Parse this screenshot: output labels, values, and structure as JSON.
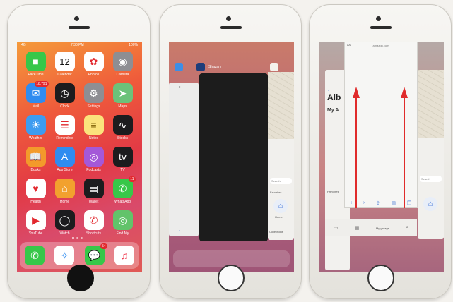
{
  "phone1": {
    "status": {
      "carrier": "4G",
      "time": "7:30 PM",
      "battery": "100%"
    },
    "apps": [
      {
        "label": "FaceTime",
        "icon": "facetime-icon",
        "color": "#37c749",
        "glyph": "■"
      },
      {
        "label": "Calendar",
        "icon": "calendar-icon",
        "color": "#ffffff",
        "glyph": "12",
        "sub": "Tuesday"
      },
      {
        "label": "Photos",
        "icon": "photos-icon",
        "color": "#ffffff",
        "glyph": "✿"
      },
      {
        "label": "Camera",
        "icon": "camera-icon",
        "color": "#8e8e93",
        "glyph": "◉"
      },
      {
        "label": "Mail",
        "icon": "mail-icon",
        "color": "#2f8cf0",
        "glyph": "✉",
        "badge": "18,791"
      },
      {
        "label": "Clock",
        "icon": "clock-icon",
        "color": "#1c1c1e",
        "glyph": "◷"
      },
      {
        "label": "Settings",
        "icon": "settings-icon",
        "color": "#8e8e93",
        "glyph": "⚙"
      },
      {
        "label": "Maps",
        "icon": "maps-icon",
        "color": "#6cc27a",
        "glyph": "➤"
      },
      {
        "label": "Weather",
        "icon": "weather-icon",
        "color": "#3d9cf0",
        "glyph": "☀"
      },
      {
        "label": "Reminders",
        "icon": "reminders-icon",
        "color": "#ffffff",
        "glyph": "☰"
      },
      {
        "label": "Notes",
        "icon": "notes-icon",
        "color": "#fbe37c",
        "glyph": "≡"
      },
      {
        "label": "Stocks",
        "icon": "stocks-icon",
        "color": "#1c1c1e",
        "glyph": "∿"
      },
      {
        "label": "Books",
        "icon": "books-icon",
        "color": "#f39a2b",
        "glyph": "📖"
      },
      {
        "label": "App Store",
        "icon": "app-store-icon",
        "color": "#2f8cf0",
        "glyph": "A"
      },
      {
        "label": "Podcasts",
        "icon": "podcasts-icon",
        "color": "#a458d8",
        "glyph": "◎"
      },
      {
        "label": "TV",
        "icon": "apple-tv-icon",
        "color": "#1c1c1e",
        "glyph": "tv"
      },
      {
        "label": "Health",
        "icon": "health-icon",
        "color": "#ffffff",
        "glyph": "♥"
      },
      {
        "label": "Home",
        "icon": "home-app-icon",
        "color": "#f2a12e",
        "glyph": "⌂"
      },
      {
        "label": "Wallet",
        "icon": "wallet-icon",
        "color": "#1c1c1e",
        "glyph": "▤"
      },
      {
        "label": "WhatsApp",
        "icon": "whatsapp-icon",
        "color": "#37c749",
        "glyph": "✆",
        "badge": "11"
      },
      {
        "label": "YouTube",
        "icon": "youtube-icon",
        "color": "#ffffff",
        "glyph": "▶"
      },
      {
        "label": "Watch",
        "icon": "watch-icon",
        "color": "#1c1c1e",
        "glyph": "◯"
      },
      {
        "label": "Shortcuts",
        "icon": "phone-call-icon",
        "color": "#ffffff",
        "glyph": "✆"
      },
      {
        "label": "Find My",
        "icon": "find-my-icon",
        "color": "#62c36a",
        "glyph": "◎"
      }
    ],
    "dock": [
      {
        "label": "Phone",
        "icon": "phone-icon",
        "color": "#37c749",
        "glyph": "✆"
      },
      {
        "label": "Safari",
        "icon": "safari-icon",
        "color": "#ffffff",
        "glyph": "✧"
      },
      {
        "label": "Messages",
        "icon": "messages-icon",
        "color": "#37c749",
        "glyph": "💬",
        "badge": "54"
      },
      {
        "label": "Music",
        "icon": "music-icon",
        "color": "#ffffff",
        "glyph": "♫"
      }
    ]
  },
  "phone2": {
    "switcher_title": "Shazam",
    "search_label": "Search",
    "favorites_label": "Favorites",
    "home_label": "Home",
    "collections_label": "Collections"
  },
  "phone3": {
    "url": "amazon.com",
    "aa_label": "aA",
    "back_card_title": "Alb",
    "back_card_sub": "My A",
    "favorites_label": "Favorites",
    "my_garage_label": "My garage",
    "search_label": "Search",
    "arrow_color": "#e02b2b"
  }
}
